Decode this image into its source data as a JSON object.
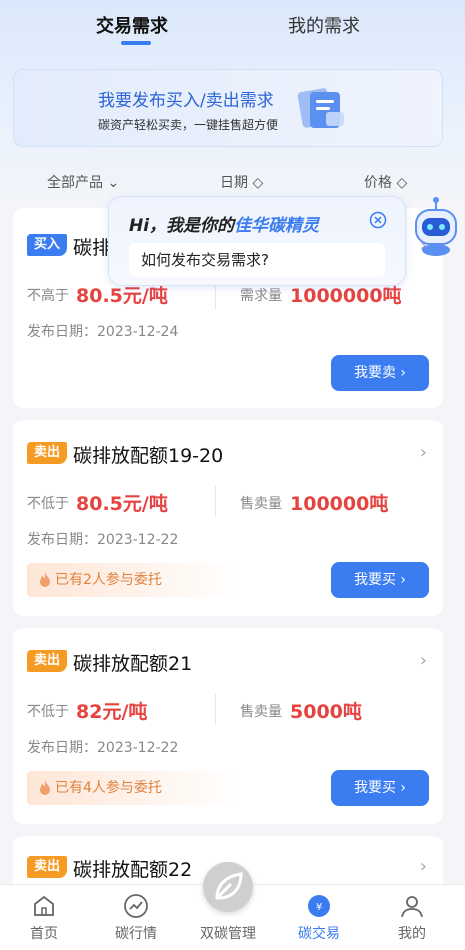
{
  "tabs": {
    "trade": "交易需求",
    "mine": "我的需求"
  },
  "banner": {
    "title": "我要发布买入/卖出需求",
    "subtitle": "碳资产轻松买卖，一键挂售超方便"
  },
  "filters": {
    "product": "全部产品 ⌄",
    "date": "日期 ◇",
    "price": "价格 ◇"
  },
  "popup": {
    "hi": "Hi，我是你的",
    "name": "佳华碳精灵",
    "question": "如何发布交易需求?"
  },
  "cards": [
    {
      "tag": "买入",
      "title": "碳排放配额18",
      "price_label": "不高于",
      "price": "80.5元/吨",
      "qty_label": "需求量",
      "qty": "1000000吨",
      "date": "发布日期：2023-12-24",
      "button": "我要卖 ›",
      "hint": ""
    },
    {
      "tag": "卖出",
      "title": "碳排放配额19-20",
      "price_label": "不低于",
      "price": "80.5元/吨",
      "qty_label": "售卖量",
      "qty": "100000吨",
      "date": "发布日期：2023-12-22",
      "button": "我要买 ›",
      "hint": "已有2人参与委托"
    },
    {
      "tag": "卖出",
      "title": "碳排放配额21",
      "price_label": "不低于",
      "price": "82元/吨",
      "qty_label": "售卖量",
      "qty": "5000吨",
      "date": "发布日期：2023-12-22",
      "button": "我要买 ›",
      "hint": "已有4人参与委托"
    },
    {
      "tag": "卖出",
      "title": "碳排放配额22"
    }
  ],
  "nav": {
    "home": "首页",
    "market": "碳行情",
    "dual": "双碳管理",
    "trade": "碳交易",
    "me": "我的"
  },
  "colors": {
    "accent": "#3b7cf0",
    "price": "#e64340",
    "sell_tag": "#f59a23"
  }
}
